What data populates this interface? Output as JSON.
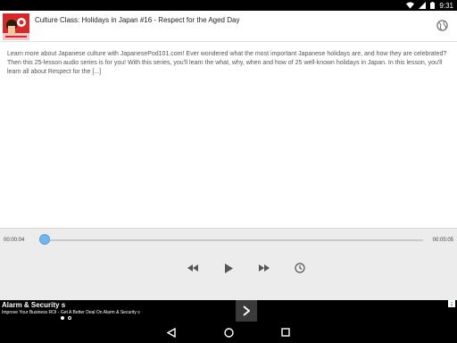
{
  "status_bar": {
    "time": "9:31",
    "icons": [
      "wifi-icon",
      "signal-icon",
      "battery-icon"
    ]
  },
  "episode": {
    "title": "Culture Class: Holidays in Japan #16 - Respect for the Aged Day",
    "thumbnail_icon": "podcast-thumbnail",
    "description": "Learn more about Japanese culture with JapanesePod101.com! Ever wondered what the most important Japanese holidays are, and how they are celebrated? Then this 25-lesson audio series is for you! With this series, you'll learn the what, why, when and how of 25 well-known holidays in Japan. In this lesson, you'll learn all about Respect for the [...]"
  },
  "player": {
    "elapsed": "00:00:04",
    "duration": "00:05:05",
    "progress_fraction": 0.013,
    "buttons": [
      "rewind-icon",
      "play-icon",
      "fast-forward-icon",
      "timer-icon"
    ]
  },
  "ad": {
    "title": "Alarm & Security s",
    "subtitle": "Improve Your Business ROI - Get A Better Deal On Alarm & Security s",
    "cta_icon": "chevron-right-icon"
  },
  "nav": {
    "buttons": [
      "back-icon",
      "home-icon",
      "recents-icon"
    ]
  },
  "colors": {
    "accent": "#75b6ea",
    "thumbnail_bg": "#d22a2a"
  }
}
